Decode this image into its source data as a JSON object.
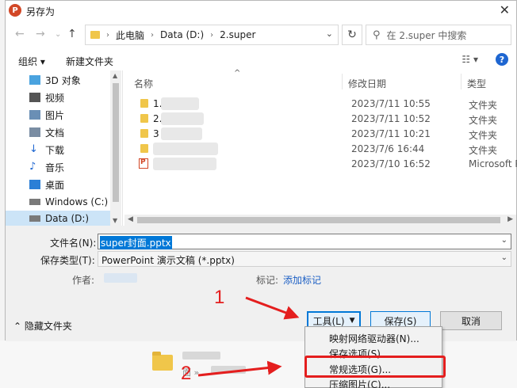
{
  "window": {
    "title": "另存为",
    "close_glyph": "✕",
    "app_icon_letter": "P"
  },
  "address": {
    "breadcrumbs": [
      "此电脑",
      "Data (D:)",
      "2.super"
    ],
    "search_placeholder": "在 2.super 中搜索"
  },
  "toolbar": {
    "organize": "组织 ▾",
    "new_folder": "新建文件夹"
  },
  "nav_pane": {
    "items": [
      {
        "label": "3D 对象",
        "icon": "3d-objects-icon",
        "color": "#4aa3df"
      },
      {
        "label": "视频",
        "icon": "video-icon",
        "color": "#555555"
      },
      {
        "label": "图片",
        "icon": "pictures-icon",
        "color": "#6a8fb5"
      },
      {
        "label": "文档",
        "icon": "documents-icon",
        "color": "#7a8da3"
      },
      {
        "label": "下载",
        "icon": "download-icon",
        "color": "#1e66d1"
      },
      {
        "label": "音乐",
        "icon": "music-icon",
        "color": "#1e66d1"
      },
      {
        "label": "桌面",
        "icon": "desktop-icon",
        "color": "#2b7fd6"
      },
      {
        "label": "Windows (C:)",
        "icon": "drive-icon",
        "color": "#7a7a7a"
      },
      {
        "label": "Data (D:)",
        "icon": "drive-icon",
        "color": "#7a7a7a"
      }
    ]
  },
  "file_list": {
    "columns": {
      "name": "名称",
      "modified": "修改日期",
      "type": "类型"
    },
    "rows": [
      {
        "name": "1.",
        "date": "2023/7/11 10:55",
        "type": "文件夹",
        "kind": "folder"
      },
      {
        "name": "2.",
        "date": "2023/7/11 10:52",
        "type": "文件夹",
        "kind": "folder"
      },
      {
        "name": "3",
        "date": "2023/7/11 10:21",
        "type": "文件夹",
        "kind": "folder"
      },
      {
        "name": "",
        "date": "2023/7/6 16:44",
        "type": "文件夹",
        "kind": "folder"
      },
      {
        "name": "",
        "date": "2023/7/10 16:52",
        "type": "Microsoft Po",
        "kind": "pptx"
      }
    ]
  },
  "form": {
    "filename_label": "文件名(N):",
    "filename_value": "super封面.pptx",
    "filetype_label": "保存类型(T):",
    "filetype_value": "PowerPoint 演示文稿 (*.pptx)",
    "author_label": "作者:",
    "tags_label": "标记:",
    "tags_link": "添加标记"
  },
  "footer": {
    "hide_folders": "隐藏文件夹",
    "tools_button": "工具(L)",
    "save_button": "保存(S)",
    "cancel_button": "取消"
  },
  "tools_menu": {
    "items": [
      "映射网络驱动器(N)...",
      "保存选项(S)...",
      "常规选项(G)...",
      "压缩图片(C)..."
    ]
  },
  "annotations": {
    "step1": "1",
    "step2": "2",
    "color": "#e41e1e"
  },
  "background": {
    "crumb_text": "面 »"
  }
}
